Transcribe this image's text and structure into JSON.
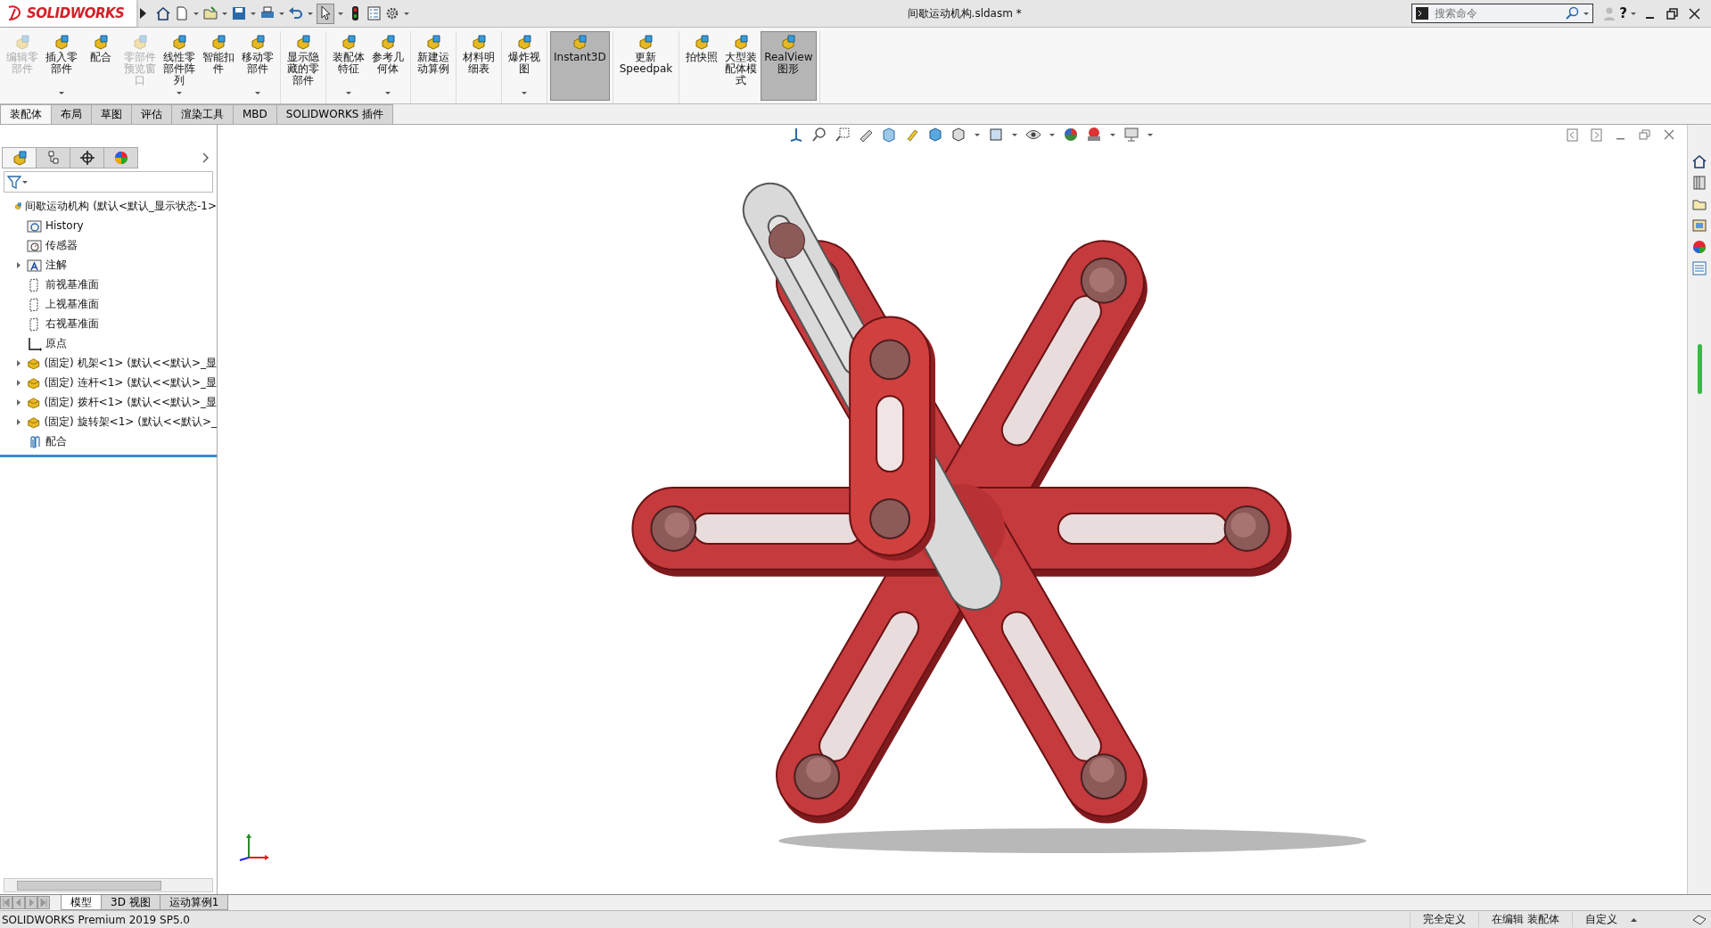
{
  "title_bar": {
    "logo": "SOLIDWORKS",
    "document_title": "间歇运动机构.sldasm *",
    "search": {
      "placeholder": "搜索命令"
    },
    "help": "?"
  },
  "ribbon": {
    "groups": [
      [
        {
          "label": "编辑零部件",
          "disabled": true,
          "selected": false,
          "dropdown": false
        },
        {
          "label": "插入零部件",
          "disabled": false,
          "selected": false,
          "dropdown": true
        },
        {
          "label": "配合",
          "disabled": false,
          "selected": false,
          "dropdown": false
        },
        {
          "label": "零部件预览窗口",
          "disabled": true,
          "selected": false,
          "dropdown": false
        },
        {
          "label": "线性零部件阵列",
          "disabled": false,
          "selected": false,
          "dropdown": true
        },
        {
          "label": "智能扣件",
          "disabled": false,
          "selected": false,
          "dropdown": false
        },
        {
          "label": "移动零部件",
          "disabled": false,
          "selected": false,
          "dropdown": true
        }
      ],
      [
        {
          "label": "显示隐藏的零部件",
          "disabled": false,
          "selected": false,
          "dropdown": false
        }
      ],
      [
        {
          "label": "装配体特征",
          "disabled": false,
          "selected": false,
          "dropdown": true
        },
        {
          "label": "参考几何体",
          "disabled": false,
          "selected": false,
          "dropdown": true
        }
      ],
      [
        {
          "label": "新建运动算例",
          "disabled": false,
          "selected": false,
          "dropdown": false
        }
      ],
      [
        {
          "label": "材料明细表",
          "disabled": false,
          "selected": false,
          "dropdown": false
        }
      ],
      [
        {
          "label": "爆炸视图",
          "disabled": false,
          "selected": false,
          "dropdown": true
        }
      ],
      [
        {
          "label": "Instant3D",
          "disabled": false,
          "selected": true,
          "dropdown": false
        }
      ],
      [
        {
          "label": "更新 Speedpak",
          "disabled": false,
          "selected": false,
          "dropdown": false
        }
      ],
      [
        {
          "label": "拍快照",
          "disabled": false,
          "selected": false,
          "dropdown": false
        },
        {
          "label": "大型装配体模式",
          "disabled": false,
          "selected": false,
          "dropdown": false
        },
        {
          "label": "RealView 图形",
          "disabled": false,
          "selected": true,
          "dropdown": false
        }
      ]
    ]
  },
  "command_tabs": [
    {
      "label": "装配体",
      "selected": true
    },
    {
      "label": "布局",
      "selected": false
    },
    {
      "label": "草图",
      "selected": false
    },
    {
      "label": "评估",
      "selected": false
    },
    {
      "label": "渲染工具",
      "selected": false
    },
    {
      "label": "MBD",
      "selected": false
    },
    {
      "label": "SOLIDWORKS 插件",
      "selected": false
    }
  ],
  "panel_tabs": [
    {
      "selected": true
    },
    {
      "selected": false
    },
    {
      "selected": false
    },
    {
      "selected": false
    }
  ],
  "feature_tree": {
    "root": {
      "label": "间歇运动机构  (默认<默认_显示状态-1>",
      "kind": "assembly",
      "children": [
        {
          "label": "History",
          "kind": "history"
        },
        {
          "label": "传感器",
          "kind": "sensors"
        },
        {
          "label": "注解",
          "kind": "annotations",
          "expanded": false
        },
        {
          "label": "前视基准面",
          "kind": "plane"
        },
        {
          "label": "上视基准面",
          "kind": "plane"
        },
        {
          "label": "右视基准面",
          "kind": "plane"
        },
        {
          "label": "原点",
          "kind": "origin"
        },
        {
          "label": "(固定) 机架<1> (默认<<默认>_显",
          "kind": "part",
          "expanded": false
        },
        {
          "label": "(固定) 连杆<1> (默认<<默认>_显",
          "kind": "part",
          "expanded": false
        },
        {
          "label": "(固定) 拨杆<1> (默认<<默认>_显",
          "kind": "part",
          "expanded": false
        },
        {
          "label": "(固定) 旋转架<1> (默认<<默认>_",
          "kind": "part",
          "expanded": false
        },
        {
          "label": "配合",
          "kind": "mates"
        }
      ]
    }
  },
  "bottom_tabs": [
    {
      "label": "模型",
      "selected": true
    },
    {
      "label": "3D 视图",
      "selected": false
    },
    {
      "label": "运动算例1",
      "selected": false
    }
  ],
  "status_bar": {
    "product": "SOLIDWORKS Premium 2019 SP5.0",
    "fields": [
      "完全定义",
      "在编辑 装配体",
      "自定义"
    ]
  }
}
